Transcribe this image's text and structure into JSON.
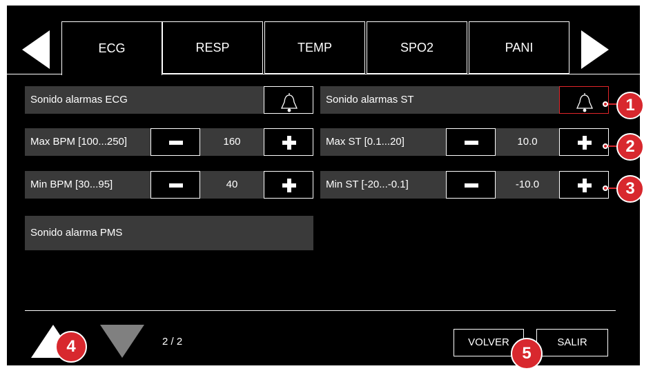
{
  "tabs": [
    "ECG",
    "RESP",
    "TEMP",
    "SPO2",
    "PANI"
  ],
  "rows": {
    "ecg_alarm_sound": "Sonido alarmas ECG",
    "st_alarm_sound": "Sonido alarmas ST",
    "max_bpm": {
      "label": "Max BPM [100...250]",
      "value": "160"
    },
    "max_st": {
      "label": "Max ST [0.1...20]",
      "value": "10.0"
    },
    "min_bpm": {
      "label": "Min BPM [30...95]",
      "value": "40"
    },
    "min_st": {
      "label": "Min ST [-20...-0.1]",
      "value": "-10.0"
    },
    "pms_alarm_sound": "Sonido alarma PMS"
  },
  "footer": {
    "page_indicator": "2 / 2",
    "back_label": "VOLVER",
    "exit_label": "SALIR"
  },
  "callouts": [
    "1",
    "2",
    "3",
    "4",
    "5"
  ],
  "colors": {
    "background": "#000000",
    "row": "#3a3a3a",
    "highlight": "#e32529",
    "callout": "#d8282e",
    "disabled_arrow": "#808080"
  },
  "icons": {
    "bell": "bell-icon",
    "minus": "minus-icon",
    "plus": "plus-icon",
    "prev_tab": "arrow-left-icon",
    "next_tab": "arrow-right-icon",
    "scroll_up": "arrow-up-icon",
    "scroll_down": "arrow-down-icon"
  }
}
